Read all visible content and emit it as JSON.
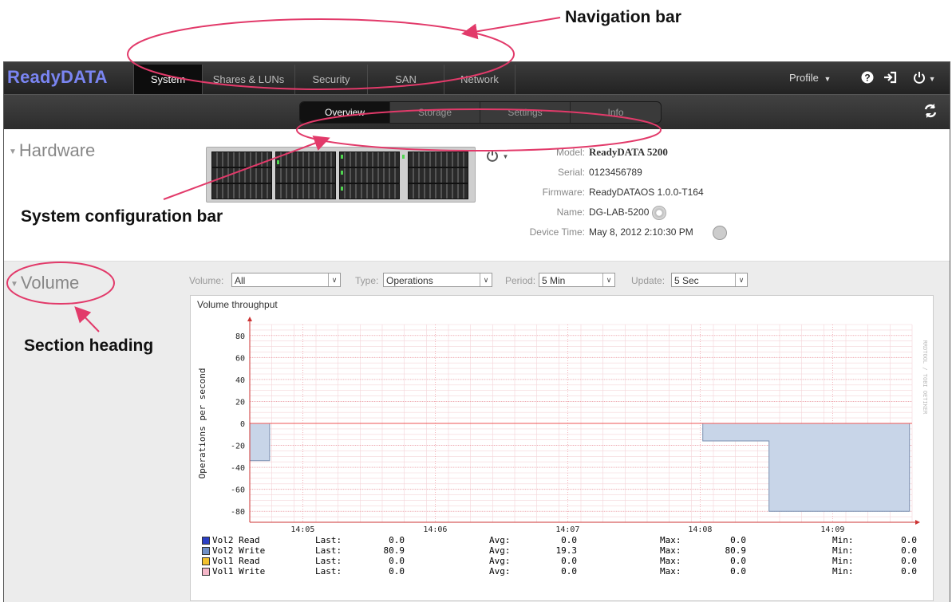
{
  "annotations": {
    "nav": "Navigation bar",
    "config": "System configuration bar",
    "section": "Section heading"
  },
  "navbar": {
    "brand": "ReadyDATA",
    "tabs": [
      {
        "label": "System",
        "active": true
      },
      {
        "label": "Shares & LUNs",
        "active": false
      },
      {
        "label": "Security",
        "active": false
      },
      {
        "label": "SAN",
        "active": false
      },
      {
        "label": "Network",
        "active": false
      }
    ],
    "profile": "Profile",
    "icons": [
      "help-icon",
      "logout-icon",
      "power-icon"
    ]
  },
  "subnav": {
    "tabs": [
      {
        "label": "Overview",
        "active": true
      },
      {
        "label": "Storage",
        "active": false
      },
      {
        "label": "Settings",
        "active": false
      },
      {
        "label": "Info",
        "active": false
      }
    ],
    "refresh_icon": "refresh-icon"
  },
  "hardware": {
    "heading": "Hardware",
    "model_label": "Model:",
    "model": "ReadyDATA 5200",
    "serial_label": "Serial:",
    "serial": "0123456789",
    "firmware_label": "Firmware:",
    "firmware": "ReadyDATAOS 1.0.0-T164",
    "name_label": "Name:",
    "name": "DG-LAB-5200",
    "time_label": "Device Time:",
    "time": "May 8, 2012 2:10:30 PM"
  },
  "volume": {
    "heading": "Volume",
    "controls": [
      {
        "label": "Volume:",
        "value": "All"
      },
      {
        "label": "Type:",
        "value": "Operations"
      },
      {
        "label": "Period:",
        "value": "5 Min"
      },
      {
        "label": "Update:",
        "value": "5 Sec"
      }
    ]
  },
  "chart_data": {
    "type": "area",
    "title": "Volume throughput",
    "ylabel": "Operations per second",
    "watermark": "RRDTOOL / TOBI OETIKER",
    "ylim": [
      -90,
      90
    ],
    "yticks": [
      80,
      60,
      40,
      20,
      0,
      -20,
      -40,
      -60,
      -80
    ],
    "xlim": [
      4.6,
      9.6
    ],
    "xticks": [
      {
        "v": 5,
        "label": "14:05"
      },
      {
        "v": 6,
        "label": "14:06"
      },
      {
        "v": 7,
        "label": "14:07"
      },
      {
        "v": 8,
        "label": "14:08"
      },
      {
        "v": 9,
        "label": "14:09"
      }
    ],
    "series": [
      {
        "name": "Vol2 Write",
        "color": "#c8d5e8",
        "line": "#7a8fb0",
        "points": [
          [
            4.6,
            0
          ],
          [
            4.6,
            -34
          ],
          [
            4.75,
            -34
          ],
          [
            4.75,
            0
          ],
          [
            8.02,
            0
          ],
          [
            8.02,
            -16
          ],
          [
            8.52,
            -16
          ],
          [
            8.52,
            -80
          ],
          [
            9.58,
            -80
          ],
          [
            9.58,
            0
          ]
        ]
      }
    ],
    "legend": [
      {
        "name": "Vol2 Read",
        "color": "#2b3fc4",
        "last_label": "Last:",
        "last": "0.0",
        "avg_label": "Avg:",
        "avg": "0.0",
        "max_label": "Max:",
        "max": "0.0",
        "min_label": "Min:",
        "min": "0.0"
      },
      {
        "name": "Vol2 Write",
        "color": "#6f8fc6",
        "last_label": "Last:",
        "last": "80.9",
        "avg_label": "Avg:",
        "avg": "19.3",
        "max_label": "Max:",
        "max": "80.9",
        "min_label": "Min:",
        "min": "0.0"
      },
      {
        "name": "Vol1 Read",
        "color": "#f2c12e",
        "last_label": "Last:",
        "last": "0.0",
        "avg_label": "Avg:",
        "avg": "0.0",
        "max_label": "Max:",
        "max": "0.0",
        "min_label": "Min:",
        "min": "0.0"
      },
      {
        "name": "Vol1 Write",
        "color": "#f4b6c8",
        "last_label": "Last:",
        "last": "0.0",
        "avg_label": "Avg:",
        "avg": "0.0",
        "max_label": "Max:",
        "max": "0.0",
        "min_label": "Min:",
        "min": "0.0"
      }
    ]
  }
}
